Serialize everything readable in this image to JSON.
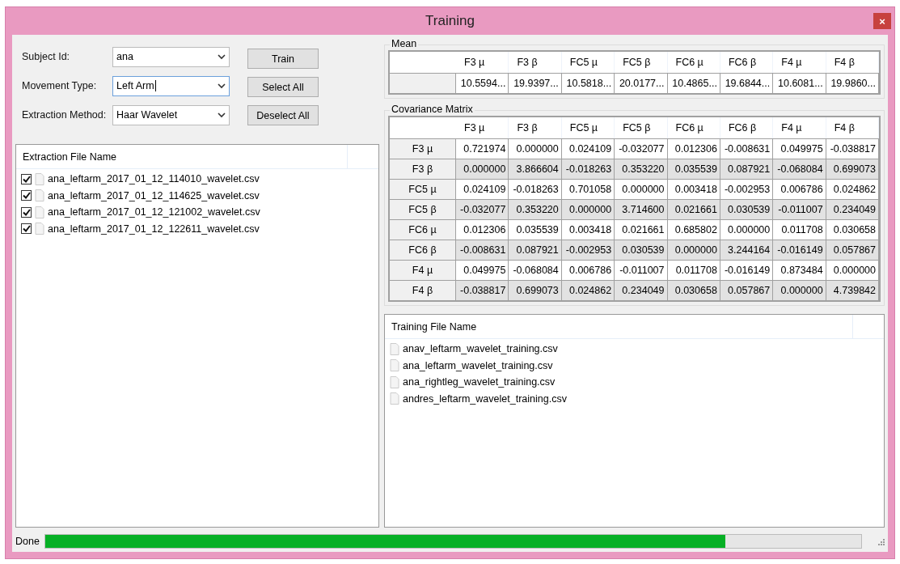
{
  "window": {
    "title": "Training",
    "close": "×"
  },
  "form": {
    "fields": [
      {
        "label": "Subject Id:",
        "value": "ana",
        "focused": false
      },
      {
        "label": "Movement Type:",
        "value": "Left Arm",
        "focused": true
      },
      {
        "label": "Extraction Method:",
        "value": "Haar Wavelet",
        "focused": false
      }
    ],
    "buttons": [
      "Train",
      "Select All",
      "Deselect All"
    ]
  },
  "extraction_files": {
    "header": "Extraction File Name",
    "items": [
      {
        "name": "ana_leftarm_2017_01_12_114010_wavelet.csv",
        "checked": true
      },
      {
        "name": "ana_leftarm_2017_01_12_114625_wavelet.csv",
        "checked": true
      },
      {
        "name": "ana_leftarm_2017_01_12_121002_wavelet.csv",
        "checked": true
      },
      {
        "name": "ana_leftarm_2017_01_12_122611_wavelet.csv",
        "checked": true
      }
    ]
  },
  "mean": {
    "title": "Mean",
    "columns": [
      "F3 µ",
      "F3 β",
      "FC5 µ",
      "FC5 β",
      "FC6 µ",
      "FC6 β",
      "F4 µ",
      "F4 β"
    ],
    "values": [
      "10.5594...",
      "19.9397...",
      "10.5818...",
      "20.0177...",
      "10.4865...",
      "19.6844...",
      "10.6081...",
      "19.9860..."
    ]
  },
  "covariance": {
    "title": "Covariance Matrix",
    "columns": [
      "F3 µ",
      "F3 β",
      "FC5 µ",
      "FC5 β",
      "FC6 µ",
      "FC6 β",
      "F4 µ",
      "F4 β"
    ],
    "rows": [
      {
        "label": "F3 µ",
        "values": [
          "0.721974",
          "0.000000",
          "0.024109",
          "-0.032077",
          "0.012306",
          "-0.008631",
          "0.049975",
          "-0.038817"
        ]
      },
      {
        "label": "F3 β",
        "values": [
          "0.000000",
          "3.866604",
          "-0.018263",
          "0.353220",
          "0.035539",
          "0.087921",
          "-0.068084",
          "0.699073"
        ]
      },
      {
        "label": "FC5 µ",
        "values": [
          "0.024109",
          "-0.018263",
          "0.701058",
          "0.000000",
          "0.003418",
          "-0.002953",
          "0.006786",
          "0.024862"
        ]
      },
      {
        "label": "FC5 β",
        "values": [
          "-0.032077",
          "0.353220",
          "0.000000",
          "3.714600",
          "0.021661",
          "0.030539",
          "-0.011007",
          "0.234049"
        ]
      },
      {
        "label": "FC6 µ",
        "values": [
          "0.012306",
          "0.035539",
          "0.003418",
          "0.021661",
          "0.685802",
          "0.000000",
          "0.011708",
          "0.030658"
        ]
      },
      {
        "label": "FC6 β",
        "values": [
          "-0.008631",
          "0.087921",
          "-0.002953",
          "0.030539",
          "0.000000",
          "3.244164",
          "-0.016149",
          "0.057867"
        ]
      },
      {
        "label": "F4 µ",
        "values": [
          "0.049975",
          "-0.068084",
          "0.006786",
          "-0.011007",
          "0.011708",
          "-0.016149",
          "0.873484",
          "0.000000"
        ]
      },
      {
        "label": "F4 β",
        "values": [
          "-0.038817",
          "0.699073",
          "0.024862",
          "0.234049",
          "0.030658",
          "0.057867",
          "0.000000",
          "4.739842"
        ]
      }
    ]
  },
  "training_files": {
    "header": "Training File Name",
    "items": [
      "anav_leftarm_wavelet_training.csv",
      "ana_leftarm_wavelet_training.csv",
      "ana_rightleg_wavelet_training.csv",
      "andres_leftarm_wavelet_training.csv"
    ]
  },
  "status_bar": {
    "text": "Done",
    "progress": {
      "level": 0.834
    }
  }
}
